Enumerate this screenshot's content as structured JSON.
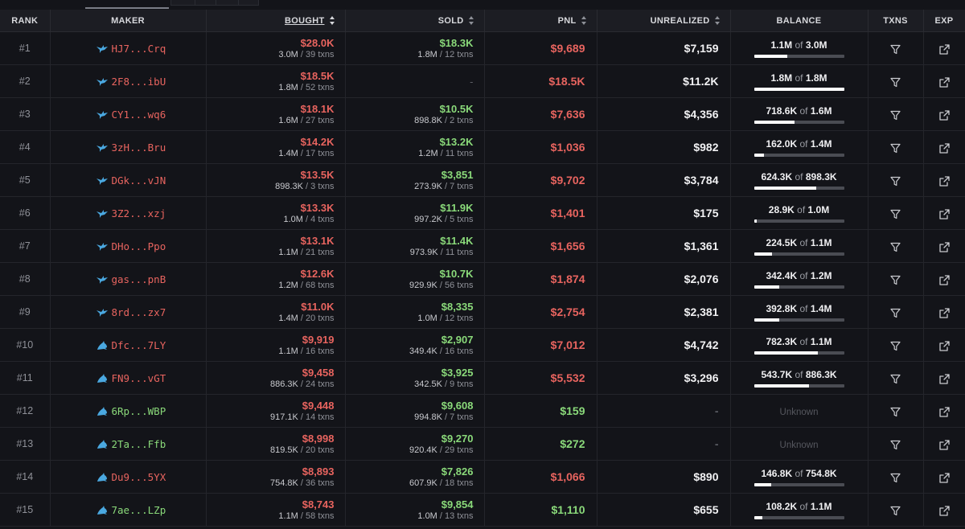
{
  "columns": {
    "rank": "RANK",
    "maker": "MAKER",
    "bought": "BOUGHT",
    "sold": "SOLD",
    "pnl": "PNL",
    "unrealized": "UNREALIZED",
    "balance": "BALANCE",
    "txns": "TXNS",
    "exp": "EXP"
  },
  "balance_of_label": "of",
  "txns_suffix": "txns",
  "colors": {
    "red": "#e8645f",
    "green": "#8ad97a",
    "bird_icon": "#4aa8e0",
    "shark_icon": "#4aa8e0"
  },
  "rows": [
    {
      "rank": "#1",
      "maker_icon": "bird-icon",
      "maker": "HJ7...Crq",
      "maker_color": "red",
      "bought": "$28.0K",
      "bought_tokens": "3.0M",
      "bought_txns": "39 txns",
      "sold": "$18.3K",
      "sold_tokens": "1.8M",
      "sold_txns": "12 txns",
      "pnl": "$9,689",
      "pnl_color": "red",
      "unrealized": "$7,159",
      "balance": "1.1M",
      "balance_total": "3.0M",
      "balance_fraction": 0.367
    },
    {
      "rank": "#2",
      "maker_icon": "bird-icon",
      "maker": "2F8...ibU",
      "maker_color": "red",
      "bought": "$18.5K",
      "bought_tokens": "1.8M",
      "bought_txns": "52 txns",
      "sold": "-",
      "sold_tokens": "",
      "sold_txns": "",
      "pnl": "$18.5K",
      "pnl_color": "red",
      "unrealized": "$11.2K",
      "balance": "1.8M",
      "balance_total": "1.8M",
      "balance_fraction": 1.0
    },
    {
      "rank": "#3",
      "maker_icon": "bird-icon",
      "maker": "CY1...wq6",
      "maker_color": "red",
      "bought": "$18.1K",
      "bought_tokens": "1.6M",
      "bought_txns": "27 txns",
      "sold": "$10.5K",
      "sold_tokens": "898.8K",
      "sold_txns": "2 txns",
      "pnl": "$7,636",
      "pnl_color": "red",
      "unrealized": "$4,356",
      "balance": "718.6K",
      "balance_total": "1.6M",
      "balance_fraction": 0.449
    },
    {
      "rank": "#4",
      "maker_icon": "bird-icon",
      "maker": "3zH...Bru",
      "maker_color": "red",
      "bought": "$14.2K",
      "bought_tokens": "1.4M",
      "bought_txns": "17 txns",
      "sold": "$13.2K",
      "sold_tokens": "1.2M",
      "sold_txns": "11 txns",
      "pnl": "$1,036",
      "pnl_color": "red",
      "unrealized": "$982",
      "balance": "162.0K",
      "balance_total": "1.4M",
      "balance_fraction": 0.116
    },
    {
      "rank": "#5",
      "maker_icon": "bird-icon",
      "maker": "DGk...vJN",
      "maker_color": "red",
      "bought": "$13.5K",
      "bought_tokens": "898.3K",
      "bought_txns": "3 txns",
      "sold": "$3,851",
      "sold_tokens": "273.9K",
      "sold_txns": "7 txns",
      "pnl": "$9,702",
      "pnl_color": "red",
      "unrealized": "$3,784",
      "balance": "624.3K",
      "balance_total": "898.3K",
      "balance_fraction": 0.695
    },
    {
      "rank": "#6",
      "maker_icon": "bird-icon",
      "maker": "3Z2...xzj",
      "maker_color": "red",
      "bought": "$13.3K",
      "bought_tokens": "1.0M",
      "bought_txns": "4 txns",
      "sold": "$11.9K",
      "sold_tokens": "997.2K",
      "sold_txns": "5 txns",
      "pnl": "$1,401",
      "pnl_color": "red",
      "unrealized": "$175",
      "balance": "28.9K",
      "balance_total": "1.0M",
      "balance_fraction": 0.029
    },
    {
      "rank": "#7",
      "maker_icon": "bird-icon",
      "maker": "DHo...Ppo",
      "maker_color": "red",
      "bought": "$13.1K",
      "bought_tokens": "1.1M",
      "bought_txns": "21 txns",
      "sold": "$11.4K",
      "sold_tokens": "973.9K",
      "sold_txns": "11 txns",
      "pnl": "$1,656",
      "pnl_color": "red",
      "unrealized": "$1,361",
      "balance": "224.5K",
      "balance_total": "1.1M",
      "balance_fraction": 0.204
    },
    {
      "rank": "#8",
      "maker_icon": "bird-icon",
      "maker": "gas...pnB",
      "maker_color": "red",
      "bought": "$12.6K",
      "bought_tokens": "1.2M",
      "bought_txns": "68 txns",
      "sold": "$10.7K",
      "sold_tokens": "929.9K",
      "sold_txns": "56 txns",
      "pnl": "$1,874",
      "pnl_color": "red",
      "unrealized": "$2,076",
      "balance": "342.4K",
      "balance_total": "1.2M",
      "balance_fraction": 0.285
    },
    {
      "rank": "#9",
      "maker_icon": "bird-icon",
      "maker": "8rd...zx7",
      "maker_color": "red",
      "bought": "$11.0K",
      "bought_tokens": "1.4M",
      "bought_txns": "20 txns",
      "sold": "$8,335",
      "sold_tokens": "1.0M",
      "sold_txns": "12 txns",
      "pnl": "$2,754",
      "pnl_color": "red",
      "unrealized": "$2,381",
      "balance": "392.8K",
      "balance_total": "1.4M",
      "balance_fraction": 0.281
    },
    {
      "rank": "#10",
      "maker_icon": "shark-icon",
      "maker": "Dfc...7LY",
      "maker_color": "red",
      "bought": "$9,919",
      "bought_tokens": "1.1M",
      "bought_txns": "16 txns",
      "sold": "$2,907",
      "sold_tokens": "349.4K",
      "sold_txns": "16 txns",
      "pnl": "$7,012",
      "pnl_color": "red",
      "unrealized": "$4,742",
      "balance": "782.3K",
      "balance_total": "1.1M",
      "balance_fraction": 0.711
    },
    {
      "rank": "#11",
      "maker_icon": "shark-icon",
      "maker": "FN9...vGT",
      "maker_color": "red",
      "bought": "$9,458",
      "bought_tokens": "886.3K",
      "bought_txns": "24 txns",
      "sold": "$3,925",
      "sold_tokens": "342.5K",
      "sold_txns": "9 txns",
      "pnl": "$5,532",
      "pnl_color": "red",
      "unrealized": "$3,296",
      "balance": "543.7K",
      "balance_total": "886.3K",
      "balance_fraction": 0.613
    },
    {
      "rank": "#12",
      "maker_icon": "shark-icon",
      "maker": "6Rp...WBP",
      "maker_color": "green",
      "bought": "$9,448",
      "bought_tokens": "917.1K",
      "bought_txns": "14 txns",
      "sold": "$9,608",
      "sold_tokens": "994.8K",
      "sold_txns": "7 txns",
      "pnl": "$159",
      "pnl_color": "green",
      "unrealized": "-",
      "balance": "Unknown",
      "balance_total": "",
      "balance_fraction": null
    },
    {
      "rank": "#13",
      "maker_icon": "shark-icon",
      "maker": "2Ta...Ffb",
      "maker_color": "green",
      "bought": "$8,998",
      "bought_tokens": "819.5K",
      "bought_txns": "20 txns",
      "sold": "$9,270",
      "sold_tokens": "920.4K",
      "sold_txns": "29 txns",
      "pnl": "$272",
      "pnl_color": "green",
      "unrealized": "-",
      "balance": "Unknown",
      "balance_total": "",
      "balance_fraction": null
    },
    {
      "rank": "#14",
      "maker_icon": "shark-icon",
      "maker": "Du9...5YX",
      "maker_color": "red",
      "bought": "$8,893",
      "bought_tokens": "754.8K",
      "bought_txns": "36 txns",
      "sold": "$7,826",
      "sold_tokens": "607.9K",
      "sold_txns": "18 txns",
      "pnl": "$1,066",
      "pnl_color": "red",
      "unrealized": "$890",
      "balance": "146.8K",
      "balance_total": "754.8K",
      "balance_fraction": 0.194
    },
    {
      "rank": "#15",
      "maker_icon": "shark-icon",
      "maker": "7ae...LZp",
      "maker_color": "green",
      "bought": "$8,743",
      "bought_tokens": "1.1M",
      "bought_txns": "58 txns",
      "sold": "$9,854",
      "sold_tokens": "1.0M",
      "sold_txns": "13 txns",
      "pnl": "$1,110",
      "pnl_color": "green",
      "unrealized": "$655",
      "balance": "108.2K",
      "balance_total": "1.1M",
      "balance_fraction": 0.098
    }
  ]
}
